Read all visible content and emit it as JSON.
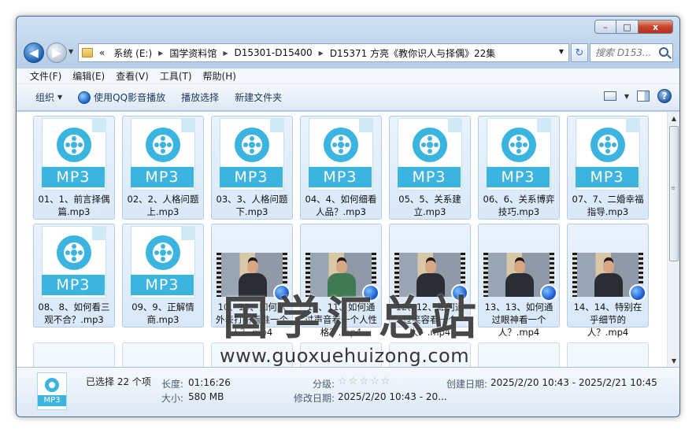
{
  "window": {
    "caption_buttons": {
      "minimize": "–",
      "maximize": "□",
      "close": "x"
    }
  },
  "nav": {
    "back_glyph": "◀",
    "forward_glyph": "▶",
    "dropdown_glyph": "▼",
    "breadcrumb_prefix": "«",
    "breadcrumbs": [
      "系统 (E:)",
      "国学资料馆",
      "D15301-D15400",
      "D15371 方亮《教你识人与择偶》22集"
    ],
    "refresh_glyph": "↻",
    "search_placeholder": "搜索 D153..."
  },
  "menu": [
    "文件(F)",
    "编辑(E)",
    "查看(V)",
    "工具(T)",
    "帮助(H)"
  ],
  "toolbar": {
    "organize": "组织",
    "play_qq": "使用QQ影音播放",
    "play_selected": "播放选择",
    "new_folder": "新建文件夹",
    "help_glyph": "?"
  },
  "files": [
    {
      "name": "01、1、前言择偶篇.mp3",
      "type": "mp3"
    },
    {
      "name": "02、2、人格问题上.mp3",
      "type": "mp3"
    },
    {
      "name": "03、3、人格问题下.mp3",
      "type": "mp3"
    },
    {
      "name": "04、4、如何细看人品？.mp3",
      "type": "mp3"
    },
    {
      "name": "05、5、关系建立.mp3",
      "type": "mp3"
    },
    {
      "name": "06、6、关系博弈技巧.mp3",
      "type": "mp3"
    },
    {
      "name": "07、7、二婚幸福指导.mp3",
      "type": "mp3"
    },
    {
      "name": "08、8、如何看三观不合？.mp3",
      "type": "mp3"
    },
    {
      "name": "09、9、正解情商.mp3",
      "type": "mp3"
    },
    {
      "name": "10、10、如何从外表打扮看准一个人？.mp4",
      "type": "mp4"
    },
    {
      "name": "11、11、如何通过声音看一个人性格？.mp4",
      "type": "mp4"
    },
    {
      "name": "12、12、如何通过笑容看一个人？.mp4",
      "type": "mp4"
    },
    {
      "name": "13、13、如何通过眼神看一个人？.mp4",
      "type": "mp4"
    },
    {
      "name": "14、14、特别在乎细节的人？.mp4",
      "type": "mp4"
    }
  ],
  "mp3_label": "MP3",
  "watermark": {
    "cn": "国学汇总站",
    "url": "www.guoxuehuizong.com"
  },
  "details": {
    "selected": "已选择 22 个项",
    "length_key": "长度:",
    "length_val": "01:16:26",
    "size_key": "大小:",
    "size_val": "580 MB",
    "rating_key": "分级:",
    "rating_stars": "☆☆☆☆☆",
    "modified_key": "修改日期:",
    "modified_val": "2025/2/20 10:43 - 20...",
    "created_key": "创建日期:",
    "created_val": "2025/2/20 10:43 - 2025/2/21 10:45",
    "icon_label": "MP3"
  },
  "scroll": {
    "up": "▲",
    "down": "▼",
    "grip": "≡"
  }
}
